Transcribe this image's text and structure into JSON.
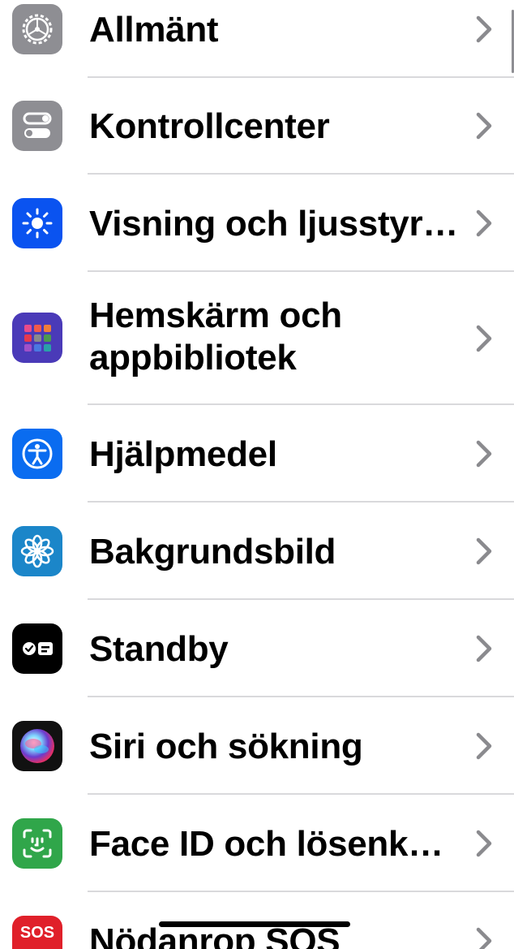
{
  "settings": {
    "items": [
      {
        "label": "Allmänt",
        "icon": "gear-icon",
        "color": "#8e8e93"
      },
      {
        "label": "Kontrollcenter",
        "icon": "toggles-icon",
        "color": "#8e8e93"
      },
      {
        "label": "Visning och ljusstyr…",
        "icon": "sun-icon",
        "color": "#0a53f0"
      },
      {
        "label": "Hemskärm och appbibliotek",
        "icon": "app-grid-icon",
        "color": "#4a3ab8"
      },
      {
        "label": "Hjälpmedel",
        "icon": "accessibility-icon",
        "color": "#0a6cf0"
      },
      {
        "label": "Bakgrundsbild",
        "icon": "flower-icon",
        "color": "#1b86c9"
      },
      {
        "label": "Standby",
        "icon": "standby-icon",
        "color": "#000000"
      },
      {
        "label": "Siri och sökning",
        "icon": "siri-icon",
        "color": "#222222"
      },
      {
        "label": "Face ID och lösenk…",
        "icon": "face-id-icon",
        "color": "#30a64a"
      },
      {
        "label": "Nödanrop SOS",
        "icon": "sos-icon",
        "color": "#e0202a"
      }
    ]
  }
}
